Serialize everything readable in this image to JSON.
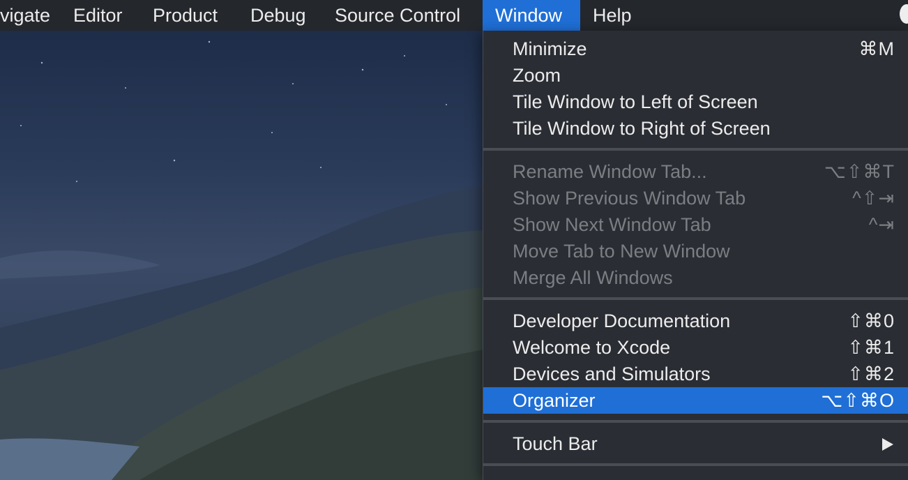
{
  "menubar": {
    "items": [
      "vigate",
      "Editor",
      "Product",
      "Debug",
      "Source Control",
      "Window",
      "Help"
    ]
  },
  "window_menu": {
    "group1": [
      {
        "label": "Minimize",
        "shortcut": "⌘M"
      },
      {
        "label": "Zoom",
        "shortcut": ""
      },
      {
        "label": "Tile Window to Left of Screen",
        "shortcut": ""
      },
      {
        "label": "Tile Window to Right of Screen",
        "shortcut": ""
      }
    ],
    "group2": [
      {
        "label": "Rename Window Tab...",
        "shortcut": "⌥⇧⌘T"
      },
      {
        "label": "Show Previous Window Tab",
        "shortcut": "^⇧⇥"
      },
      {
        "label": "Show Next Window Tab",
        "shortcut": "^⇥"
      },
      {
        "label": "Move Tab to New Window",
        "shortcut": ""
      },
      {
        "label": "Merge All Windows",
        "shortcut": ""
      }
    ],
    "group3": [
      {
        "label": "Developer Documentation",
        "shortcut": "⇧⌘0"
      },
      {
        "label": "Welcome to Xcode",
        "shortcut": "⇧⌘1"
      },
      {
        "label": "Devices and Simulators",
        "shortcut": "⇧⌘2"
      },
      {
        "label": "Organizer",
        "shortcut": "⌥⇧⌘O"
      }
    ],
    "group4": [
      {
        "label": "Touch Bar",
        "submenu_icon": "right-triangle-icon"
      }
    ]
  },
  "colors": {
    "highlight": "#1f6fd6",
    "menu_bg": "#2a2d33",
    "menubar_bg": "#24272c"
  }
}
